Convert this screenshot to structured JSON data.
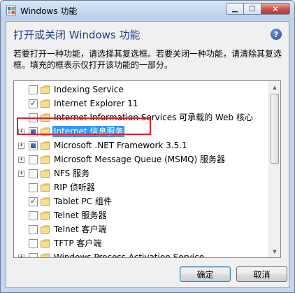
{
  "window": {
    "title": "Windows 功能",
    "minimize_label": "▁",
    "maximize_label": "▢",
    "close_label": "✕"
  },
  "heading": "打开或关闭 Windows 功能",
  "help_label": "?",
  "description": "若要打开一种功能，请选择其复选框。若要关闭一种功能，请清除其复选框。填充的框表示仅打开该功能的一部分。",
  "features": [
    {
      "label": "Indexing Service",
      "state": "unchecked",
      "expandable": false
    },
    {
      "label": "Internet Explorer 11",
      "state": "checked",
      "expandable": false
    },
    {
      "label": "Internet Information Services 可承载的 Web 核心",
      "state": "unchecked",
      "expandable": false
    },
    {
      "label": "Internet 信息服务",
      "state": "partial",
      "expandable": true,
      "selected": true
    },
    {
      "label": "Microsoft .NET Framework 3.5.1",
      "state": "partial",
      "expandable": true
    },
    {
      "label": "Microsoft Message Queue (MSMQ) 服务器",
      "state": "unchecked",
      "expandable": true
    },
    {
      "label": "NFS 服务",
      "state": "unchecked",
      "expandable": true
    },
    {
      "label": "RIP 侦听器",
      "state": "unchecked",
      "expandable": false
    },
    {
      "label": "Tablet PC 组件",
      "state": "checked",
      "expandable": false
    },
    {
      "label": "Telnet 服务器",
      "state": "unchecked",
      "expandable": false
    },
    {
      "label": "Telnet 客户端",
      "state": "unchecked",
      "expandable": false
    },
    {
      "label": "TFTP 客户端",
      "state": "unchecked",
      "expandable": false
    },
    {
      "label": "Windows Process Activation Service",
      "state": "unchecked",
      "expandable": true
    }
  ],
  "buttons": {
    "ok": "确定",
    "cancel": "取消"
  },
  "colors": {
    "heading": "#1e3f8c",
    "selection": "#3399ff",
    "highlight_box": "#e0202a"
  },
  "icons": {
    "title": "windows-features-icon",
    "folder": "folder-icon",
    "help": "help-icon"
  }
}
